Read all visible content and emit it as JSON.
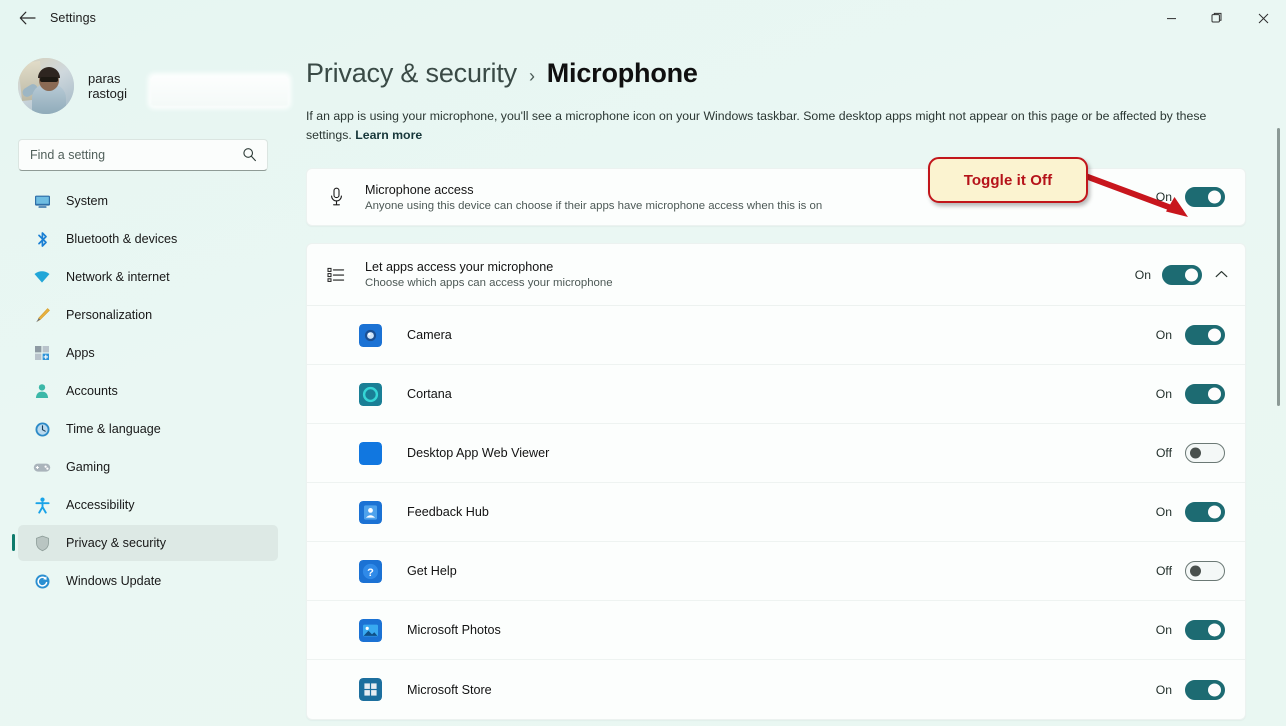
{
  "window": {
    "title": "Settings",
    "back_icon": "back-arrow-icon",
    "minimize_label": "Minimize",
    "maximize_label": "Restore",
    "close_label": "Close"
  },
  "sidebar": {
    "profile": {
      "name": "paras rastogi",
      "email_redacted": ""
    },
    "search": {
      "placeholder": "Find a setting",
      "value": "",
      "icon": "search-icon"
    },
    "items": [
      {
        "label": "System",
        "icon": "monitor-icon",
        "active": false
      },
      {
        "label": "Bluetooth & devices",
        "icon": "bluetooth-icon",
        "active": false
      },
      {
        "label": "Network & internet",
        "icon": "wifi-icon",
        "active": false
      },
      {
        "label": "Personalization",
        "icon": "paintbrush-icon",
        "active": false
      },
      {
        "label": "Apps",
        "icon": "apps-grid-icon",
        "active": false
      },
      {
        "label": "Accounts",
        "icon": "person-icon",
        "active": false
      },
      {
        "label": "Time & language",
        "icon": "clock-icon",
        "active": false
      },
      {
        "label": "Gaming",
        "icon": "gamepad-icon",
        "active": false
      },
      {
        "label": "Accessibility",
        "icon": "accessibility-icon",
        "active": false
      },
      {
        "label": "Privacy & security",
        "icon": "shield-icon",
        "active": true
      },
      {
        "label": "Windows Update",
        "icon": "update-icon",
        "active": false
      }
    ]
  },
  "header": {
    "breadcrumb_parent": "Privacy & security",
    "breadcrumb_separator": "›",
    "breadcrumb_current": "Microphone",
    "description": "If an app is using your microphone, you'll see a microphone icon on your Windows taskbar. Some desktop apps might not appear on this page or be affected by these settings.",
    "learn_more": "Learn more"
  },
  "mic_access": {
    "title": "Microphone access",
    "subtitle": "Anyone using this device can choose if their apps have microphone access when this is on",
    "state_label": "On",
    "state": true,
    "icon": "microphone-icon"
  },
  "apps_section": {
    "title": "Let apps access your microphone",
    "subtitle": "Choose which apps can access your microphone",
    "state_label": "On",
    "state": true,
    "icon": "list-icon",
    "expand_icon": "chevron-up-icon",
    "apps": [
      {
        "name": "Camera",
        "state_label": "On",
        "state": true,
        "icon": "camera-app-icon"
      },
      {
        "name": "Cortana",
        "state_label": "On",
        "state": true,
        "icon": "cortana-app-icon"
      },
      {
        "name": "Desktop App Web Viewer",
        "state_label": "Off",
        "state": false,
        "icon": "webviewer-app-icon"
      },
      {
        "name": "Feedback Hub",
        "state_label": "On",
        "state": true,
        "icon": "feedbackhub-app-icon"
      },
      {
        "name": "Get Help",
        "state_label": "Off",
        "state": false,
        "icon": "gethelp-app-icon"
      },
      {
        "name": "Microsoft Photos",
        "state_label": "On",
        "state": true,
        "icon": "photos-app-icon"
      },
      {
        "name": "Microsoft Store",
        "state_label": "On",
        "state": true,
        "icon": "store-app-icon"
      }
    ]
  },
  "annotation": {
    "callout_text": "Toggle it Off",
    "callout_border_color": "#c2161b",
    "callout_bg_color": "#fbf3d0",
    "callout_text_color": "#b51219",
    "arrow_color": "#c8161d",
    "arrow_icon": "pointer-arrow-icon"
  },
  "theme": {
    "accent_toggle_on": "#1d6b72",
    "page_background": "#e9f6f2",
    "card_background": "#fcfefd"
  }
}
